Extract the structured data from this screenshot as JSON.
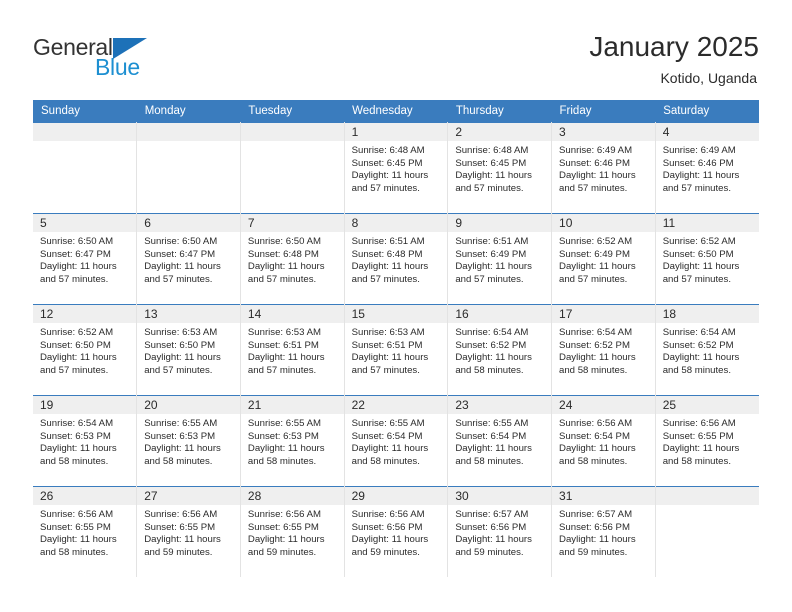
{
  "brand": {
    "name_top": "General",
    "name_bottom": "Blue",
    "triangle_color": "#1d71b8",
    "blue_text_color": "#1d8fd1"
  },
  "header": {
    "title": "January 2025",
    "subtitle": "Kotido, Uganda"
  },
  "theme": {
    "header_blue": "#3a7cbe",
    "daynum_band": "#efefef",
    "text": "#2b2b2b",
    "cell_divider": "#e3e3e3"
  },
  "calendar": {
    "weekday_headers": [
      "Sunday",
      "Monday",
      "Tuesday",
      "Wednesday",
      "Thursday",
      "Friday",
      "Saturday"
    ],
    "labels": {
      "sunrise_prefix": "Sunrise:",
      "sunset_prefix": "Sunset:",
      "daylight_prefix": "Daylight:"
    },
    "weeks": [
      [
        {
          "day": "",
          "empty": true
        },
        {
          "day": "",
          "empty": true
        },
        {
          "day": "",
          "empty": true
        },
        {
          "day": "1",
          "sunrise": "Sunrise: 6:48 AM",
          "sunset": "Sunset: 6:45 PM",
          "daylight1": "Daylight: 11 hours",
          "daylight2": "and 57 minutes."
        },
        {
          "day": "2",
          "sunrise": "Sunrise: 6:48 AM",
          "sunset": "Sunset: 6:45 PM",
          "daylight1": "Daylight: 11 hours",
          "daylight2": "and 57 minutes."
        },
        {
          "day": "3",
          "sunrise": "Sunrise: 6:49 AM",
          "sunset": "Sunset: 6:46 PM",
          "daylight1": "Daylight: 11 hours",
          "daylight2": "and 57 minutes."
        },
        {
          "day": "4",
          "sunrise": "Sunrise: 6:49 AM",
          "sunset": "Sunset: 6:46 PM",
          "daylight1": "Daylight: 11 hours",
          "daylight2": "and 57 minutes."
        }
      ],
      [
        {
          "day": "5",
          "sunrise": "Sunrise: 6:50 AM",
          "sunset": "Sunset: 6:47 PM",
          "daylight1": "Daylight: 11 hours",
          "daylight2": "and 57 minutes."
        },
        {
          "day": "6",
          "sunrise": "Sunrise: 6:50 AM",
          "sunset": "Sunset: 6:47 PM",
          "daylight1": "Daylight: 11 hours",
          "daylight2": "and 57 minutes."
        },
        {
          "day": "7",
          "sunrise": "Sunrise: 6:50 AM",
          "sunset": "Sunset: 6:48 PM",
          "daylight1": "Daylight: 11 hours",
          "daylight2": "and 57 minutes."
        },
        {
          "day": "8",
          "sunrise": "Sunrise: 6:51 AM",
          "sunset": "Sunset: 6:48 PM",
          "daylight1": "Daylight: 11 hours",
          "daylight2": "and 57 minutes."
        },
        {
          "day": "9",
          "sunrise": "Sunrise: 6:51 AM",
          "sunset": "Sunset: 6:49 PM",
          "daylight1": "Daylight: 11 hours",
          "daylight2": "and 57 minutes."
        },
        {
          "day": "10",
          "sunrise": "Sunrise: 6:52 AM",
          "sunset": "Sunset: 6:49 PM",
          "daylight1": "Daylight: 11 hours",
          "daylight2": "and 57 minutes."
        },
        {
          "day": "11",
          "sunrise": "Sunrise: 6:52 AM",
          "sunset": "Sunset: 6:50 PM",
          "daylight1": "Daylight: 11 hours",
          "daylight2": "and 57 minutes."
        }
      ],
      [
        {
          "day": "12",
          "sunrise": "Sunrise: 6:52 AM",
          "sunset": "Sunset: 6:50 PM",
          "daylight1": "Daylight: 11 hours",
          "daylight2": "and 57 minutes."
        },
        {
          "day": "13",
          "sunrise": "Sunrise: 6:53 AM",
          "sunset": "Sunset: 6:50 PM",
          "daylight1": "Daylight: 11 hours",
          "daylight2": "and 57 minutes."
        },
        {
          "day": "14",
          "sunrise": "Sunrise: 6:53 AM",
          "sunset": "Sunset: 6:51 PM",
          "daylight1": "Daylight: 11 hours",
          "daylight2": "and 57 minutes."
        },
        {
          "day": "15",
          "sunrise": "Sunrise: 6:53 AM",
          "sunset": "Sunset: 6:51 PM",
          "daylight1": "Daylight: 11 hours",
          "daylight2": "and 57 minutes."
        },
        {
          "day": "16",
          "sunrise": "Sunrise: 6:54 AM",
          "sunset": "Sunset: 6:52 PM",
          "daylight1": "Daylight: 11 hours",
          "daylight2": "and 58 minutes."
        },
        {
          "day": "17",
          "sunrise": "Sunrise: 6:54 AM",
          "sunset": "Sunset: 6:52 PM",
          "daylight1": "Daylight: 11 hours",
          "daylight2": "and 58 minutes."
        },
        {
          "day": "18",
          "sunrise": "Sunrise: 6:54 AM",
          "sunset": "Sunset: 6:52 PM",
          "daylight1": "Daylight: 11 hours",
          "daylight2": "and 58 minutes."
        }
      ],
      [
        {
          "day": "19",
          "sunrise": "Sunrise: 6:54 AM",
          "sunset": "Sunset: 6:53 PM",
          "daylight1": "Daylight: 11 hours",
          "daylight2": "and 58 minutes."
        },
        {
          "day": "20",
          "sunrise": "Sunrise: 6:55 AM",
          "sunset": "Sunset: 6:53 PM",
          "daylight1": "Daylight: 11 hours",
          "daylight2": "and 58 minutes."
        },
        {
          "day": "21",
          "sunrise": "Sunrise: 6:55 AM",
          "sunset": "Sunset: 6:53 PM",
          "daylight1": "Daylight: 11 hours",
          "daylight2": "and 58 minutes."
        },
        {
          "day": "22",
          "sunrise": "Sunrise: 6:55 AM",
          "sunset": "Sunset: 6:54 PM",
          "daylight1": "Daylight: 11 hours",
          "daylight2": "and 58 minutes."
        },
        {
          "day": "23",
          "sunrise": "Sunrise: 6:55 AM",
          "sunset": "Sunset: 6:54 PM",
          "daylight1": "Daylight: 11 hours",
          "daylight2": "and 58 minutes."
        },
        {
          "day": "24",
          "sunrise": "Sunrise: 6:56 AM",
          "sunset": "Sunset: 6:54 PM",
          "daylight1": "Daylight: 11 hours",
          "daylight2": "and 58 minutes."
        },
        {
          "day": "25",
          "sunrise": "Sunrise: 6:56 AM",
          "sunset": "Sunset: 6:55 PM",
          "daylight1": "Daylight: 11 hours",
          "daylight2": "and 58 minutes."
        }
      ],
      [
        {
          "day": "26",
          "sunrise": "Sunrise: 6:56 AM",
          "sunset": "Sunset: 6:55 PM",
          "daylight1": "Daylight: 11 hours",
          "daylight2": "and 58 minutes."
        },
        {
          "day": "27",
          "sunrise": "Sunrise: 6:56 AM",
          "sunset": "Sunset: 6:55 PM",
          "daylight1": "Daylight: 11 hours",
          "daylight2": "and 59 minutes."
        },
        {
          "day": "28",
          "sunrise": "Sunrise: 6:56 AM",
          "sunset": "Sunset: 6:55 PM",
          "daylight1": "Daylight: 11 hours",
          "daylight2": "and 59 minutes."
        },
        {
          "day": "29",
          "sunrise": "Sunrise: 6:56 AM",
          "sunset": "Sunset: 6:56 PM",
          "daylight1": "Daylight: 11 hours",
          "daylight2": "and 59 minutes."
        },
        {
          "day": "30",
          "sunrise": "Sunrise: 6:57 AM",
          "sunset": "Sunset: 6:56 PM",
          "daylight1": "Daylight: 11 hours",
          "daylight2": "and 59 minutes."
        },
        {
          "day": "31",
          "sunrise": "Sunrise: 6:57 AM",
          "sunset": "Sunset: 6:56 PM",
          "daylight1": "Daylight: 11 hours",
          "daylight2": "and 59 minutes."
        },
        {
          "day": "",
          "empty": true
        }
      ]
    ]
  }
}
